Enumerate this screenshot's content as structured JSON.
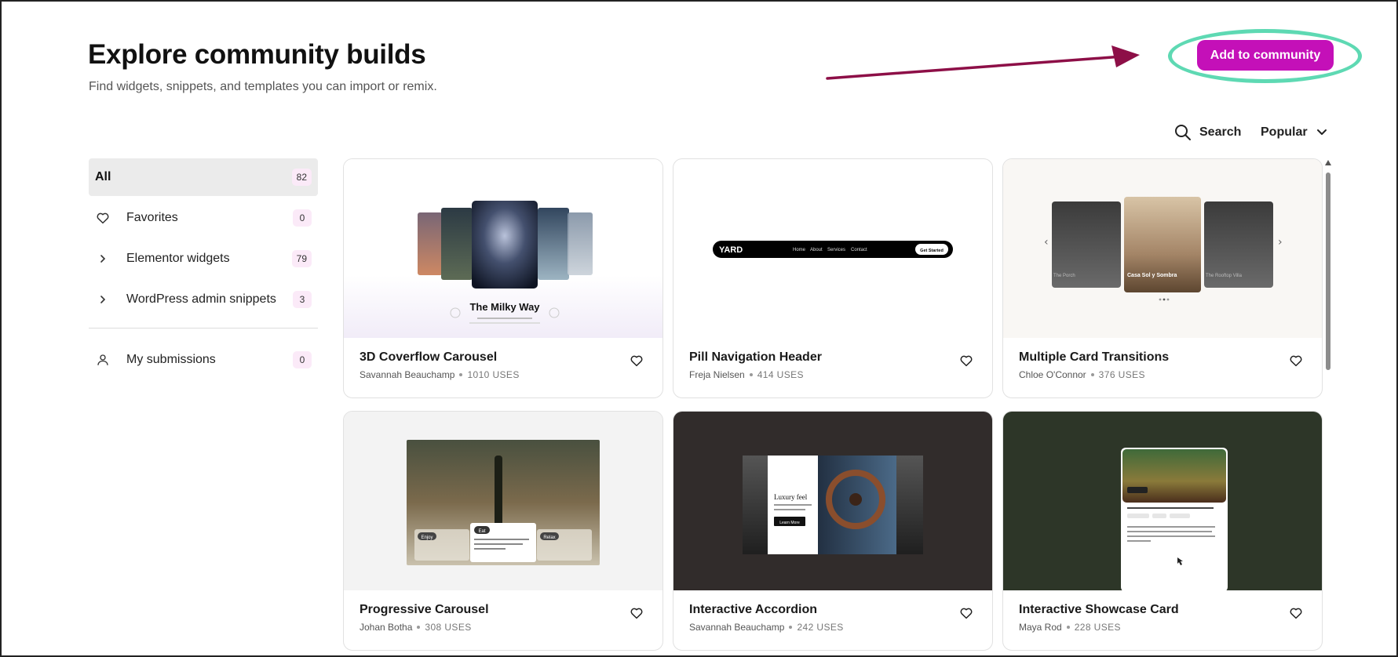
{
  "header": {
    "title": "Explore community builds",
    "subtitle": "Find widgets, snippets, and templates you can import or remix.",
    "add_button_label": "Add to community"
  },
  "toolbar": {
    "search_label": "Search",
    "sort_label": "Popular",
    "search_icon": "search-icon",
    "sort_icon": "chevron-down-icon"
  },
  "colors": {
    "accent": "#c410b8",
    "highlight_ring": "#5ed9b3",
    "arrow": "#8d0f47",
    "count_badge": "#fbeaf8"
  },
  "sidebar": {
    "items": [
      {
        "label": "All",
        "count": "82",
        "icon": "none",
        "active": true
      },
      {
        "label": "Favorites",
        "count": "0",
        "icon": "heart-icon"
      },
      {
        "label": "Elementor widgets",
        "count": "79",
        "icon": "chevron-right-icon"
      },
      {
        "label": "WordPress admin snippets",
        "count": "3",
        "icon": "chevron-right-icon"
      }
    ],
    "submissions": {
      "label": "My submissions",
      "count": "0",
      "icon": "user-icon"
    }
  },
  "cards": [
    {
      "title": "3D Coverflow Carousel",
      "author": "Savannah Beauchamp",
      "uses": "1010 USES",
      "preview_title": "The Milky Way"
    },
    {
      "title": "Pill Navigation Header",
      "author": "Freja Nielsen",
      "uses": "414 USES",
      "preview_logo": "YARD",
      "preview_links": [
        "Home",
        "About",
        "Services",
        "Contact"
      ],
      "preview_cta": "Get Started"
    },
    {
      "title": "Multiple Card Transitions",
      "author": "Chloe O'Connor",
      "uses": "376 USES",
      "preview_center": "Casa Sol y Sombra",
      "preview_left": "The Porch",
      "preview_right": "The Rooftop Villa"
    },
    {
      "title": "Progressive Carousel",
      "author": "Johan Botha",
      "uses": "308 USES",
      "preview_tags": [
        "Enjoy",
        "Eat",
        "Relax"
      ]
    },
    {
      "title": "Interactive Accordion",
      "author": "Savannah Beauchamp",
      "uses": "242 USES",
      "preview_heading": "Luxury feel",
      "preview_cta": "Learn More"
    },
    {
      "title": "Interactive Showcase Card",
      "author": "Maya Rod",
      "uses": "228 USES"
    }
  ]
}
